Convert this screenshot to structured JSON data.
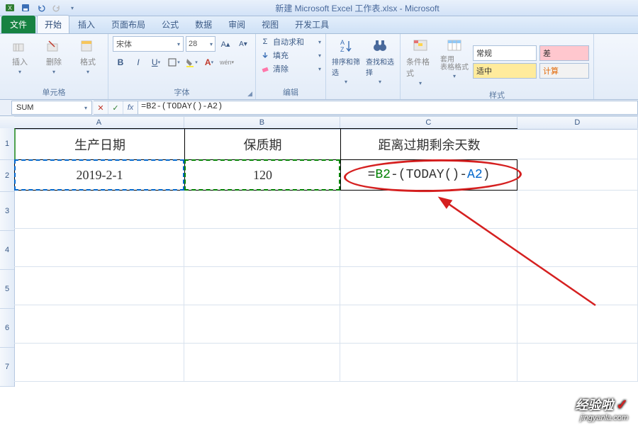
{
  "title": "新建 Microsoft Excel 工作表.xlsx - Microsoft",
  "tabs": {
    "file": "文件",
    "home": "开始",
    "insert": "插入",
    "layout": "页面布局",
    "formula": "公式",
    "data": "数据",
    "review": "审阅",
    "view": "视图",
    "dev": "开发工具"
  },
  "ribbon": {
    "cells": {
      "insert": "插入",
      "delete": "删除",
      "format": "格式",
      "group": "单元格"
    },
    "font": {
      "name": "宋体",
      "size": "28",
      "group": "字体"
    },
    "edit": {
      "autosum": "自动求和",
      "fill": "填充",
      "clear": "清除",
      "group": "编辑"
    },
    "sort": {
      "sort": "排序和筛选",
      "find": "查找和选择"
    },
    "cond": {
      "cond": "条件格式",
      "table": "套用\n表格格式"
    },
    "num": {
      "general": "常规",
      "zh": "适中",
      "diff": "差",
      "calc": "计算",
      "group": "样式"
    }
  },
  "namebox": "SUM",
  "formula_bar": "=B2-(TODAY()-A2)",
  "chart_data": {
    "type": "table",
    "columns": [
      "A",
      "B",
      "C",
      "D"
    ],
    "headers": [
      "生产日期",
      "保质期",
      "距离过期剩余天数"
    ],
    "rows": [
      {
        "A": "2019-2-1",
        "B": "120",
        "C": "=B2-(TODAY()-A2)"
      }
    ]
  },
  "cells": {
    "A1": "生产日期",
    "B1": "保质期",
    "C1": "距离过期剩余天数",
    "A2": "2019-2-1",
    "B2": "120",
    "C2_pre": "=",
    "C2_b2": "B2",
    "C2_mid": "-(TODAY()-",
    "C2_a2": "A2",
    "C2_end": ")"
  },
  "row_labels": [
    "1",
    "2",
    "3",
    "4",
    "5",
    "6",
    "7"
  ],
  "watermark": {
    "l1": "经验啦",
    "l2": "jingyanla.com"
  }
}
